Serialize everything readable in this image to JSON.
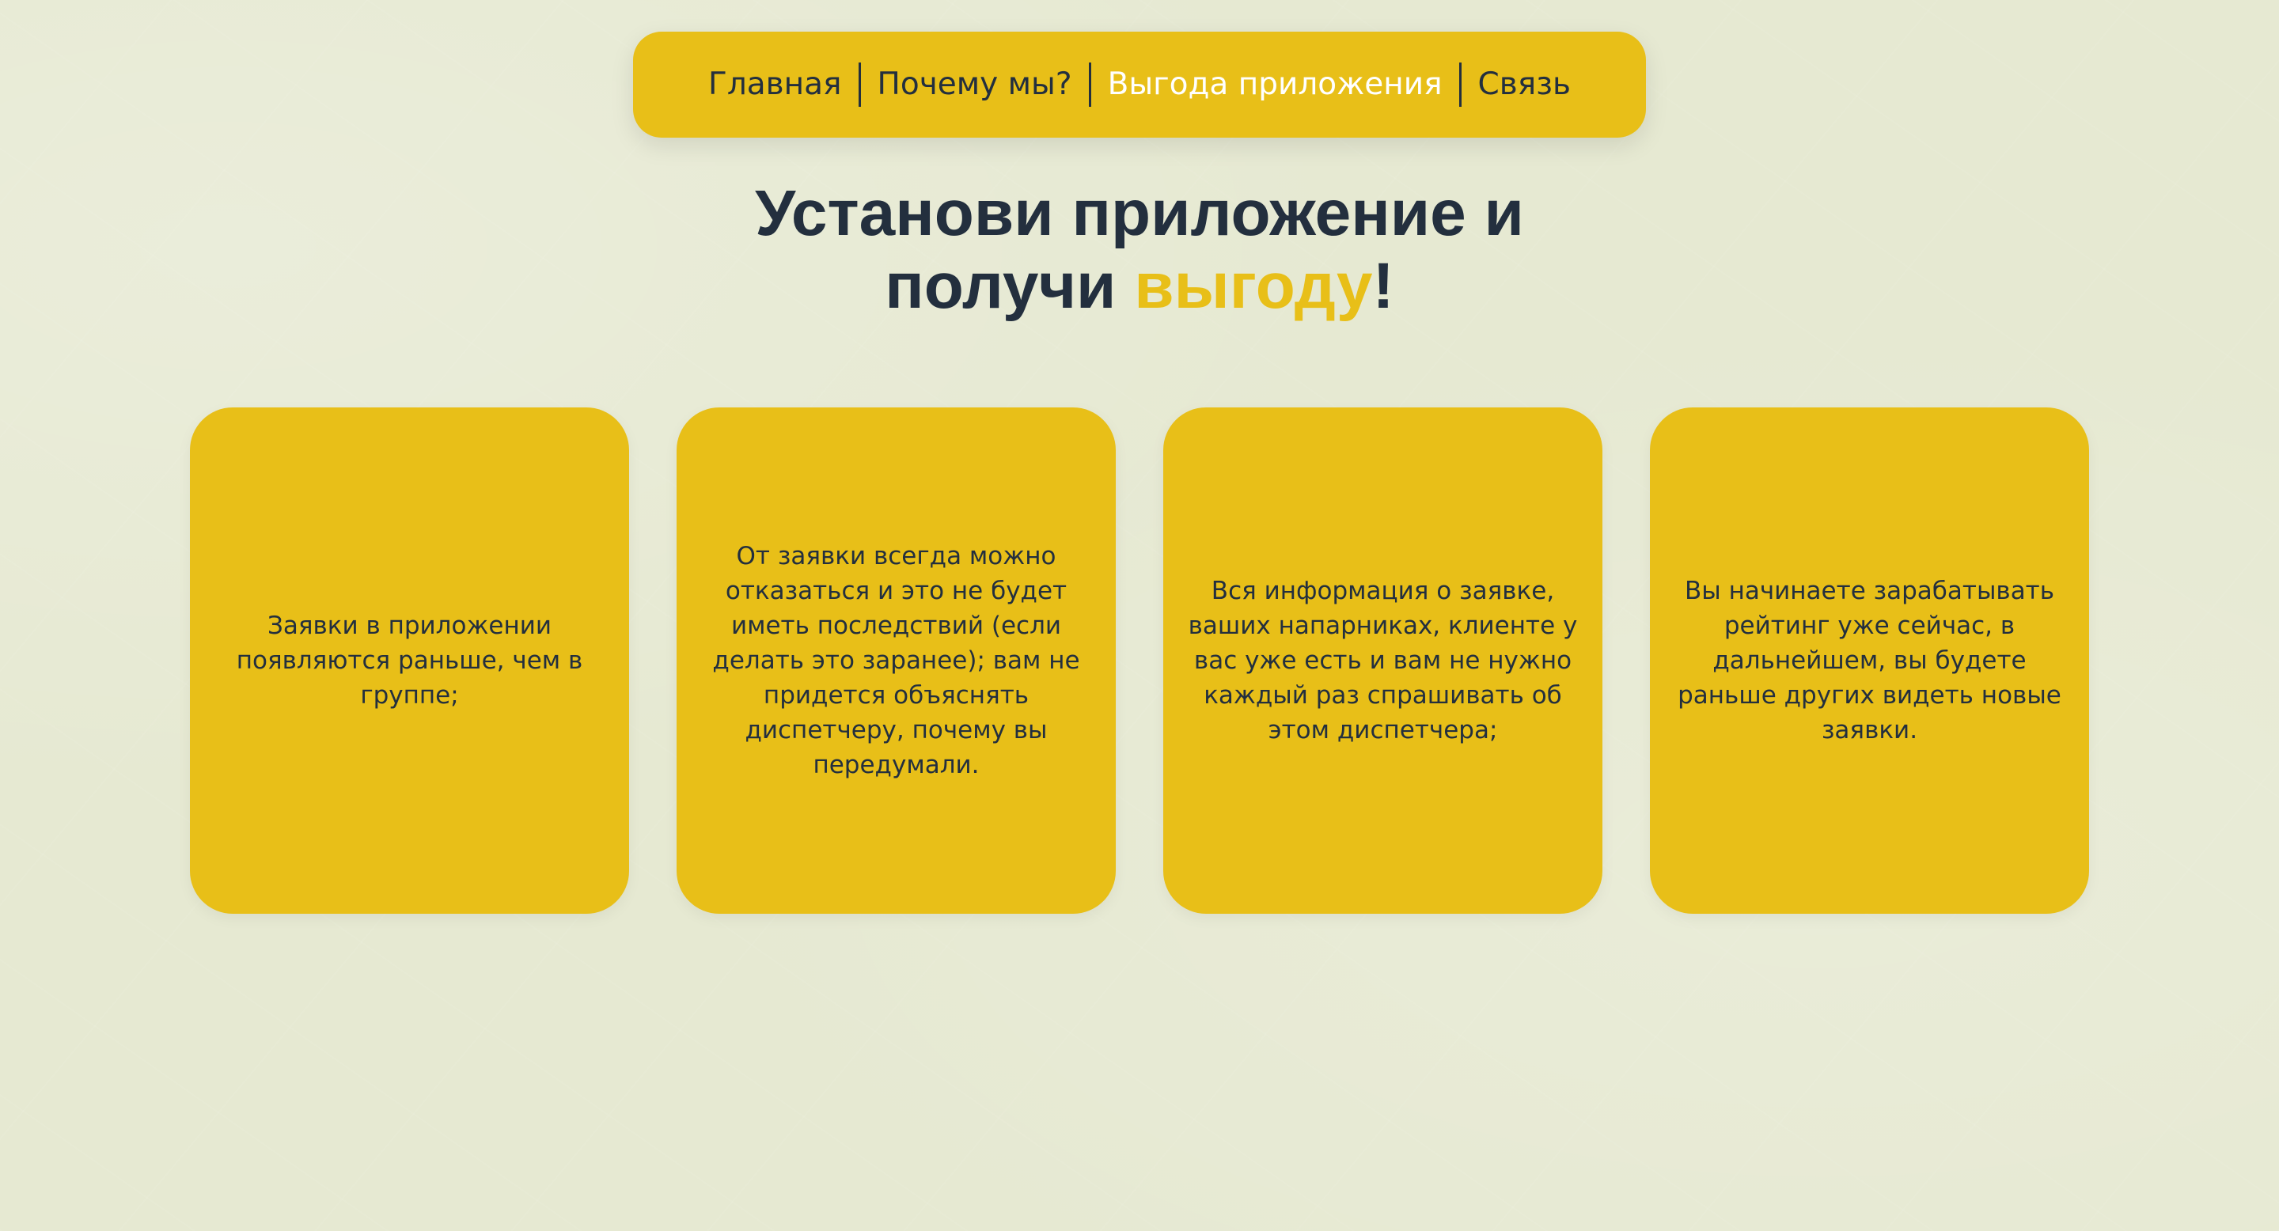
{
  "nav": {
    "items": [
      {
        "label": "Главная"
      },
      {
        "label": "Почему мы?"
      },
      {
        "label": "Выгода приложения"
      },
      {
        "label": "Связь"
      }
    ]
  },
  "headline": {
    "line1": "Установи приложение и",
    "line2_prefix": "получи ",
    "line2_accent": "выгоду",
    "line2_suffix": "!"
  },
  "cards": [
    {
      "text": "Заявки в приложении появляются раньше, чем в группе;"
    },
    {
      "text": "От заявки всегда можно отказаться и это не будет иметь последствий (если делать это заранее); вам не придется объяснять диспетчеру, почему вы передумали."
    },
    {
      "text": "Вся информация о заявке, ваших напарниках, клиенте у вас уже есть и вам не нужно каждый раз спрашивать об этом диспетчера;"
    },
    {
      "text": "Вы начинаете зарабатывать рейтинг уже сейчас, в дальнейшем, вы будете раньше других видеть новые заявки."
    }
  ],
  "colors": {
    "accent": "#e8bf18",
    "text_dark": "#232f3e",
    "background": "#e6e9d2",
    "nav_active_text": "#ffffff"
  }
}
